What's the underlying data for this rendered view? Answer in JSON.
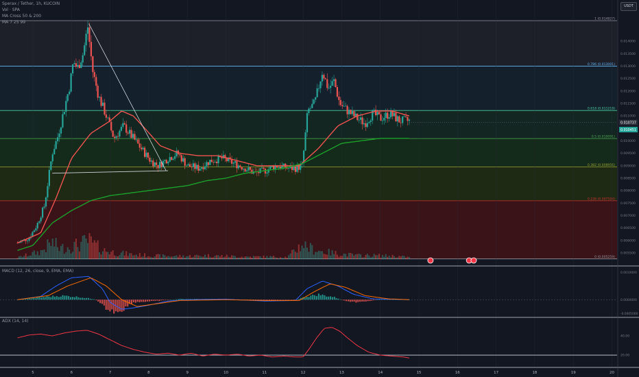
{
  "header": {
    "symbol_line": "Sperax / Tether, 1h, KUCOIN",
    "vol_line": "Vol · SPA",
    "ma1_line": "MA Cross 50 & 200",
    "ma2_line": "MA 7 25 99",
    "quote_badge": "USDT"
  },
  "colors": {
    "background": "#131722",
    "up": "#26a69a",
    "down": "#ef5350",
    "ma_fast": "#ef5350",
    "ma_slow": "#1ba12b",
    "macd": "#2962ff",
    "signal": "#ff6d00",
    "adx": "#f23645"
  },
  "chart_data": [
    {
      "type": "candlestick",
      "panel": "price",
      "title": "Sperax / Tether, 1h, KUCOIN",
      "x_ticks": [
        "5",
        "6",
        "7",
        "8",
        "9",
        "10",
        "11",
        "12",
        "13",
        "14",
        "15",
        "16",
        "17",
        "18",
        "19",
        "20"
      ],
      "y_ticks": [
        "0.014000",
        "0.013500",
        "0.013000",
        "0.012500",
        "0.012000",
        "0.011500",
        "0.011000",
        "0.010500",
        "0.010000",
        "0.009500",
        "0.009000",
        "0.008500",
        "0.008000",
        "0.007500",
        "0.007000",
        "0.006500",
        "0.006000",
        "0.005500"
      ],
      "ylim": [
        0.00525,
        0.01505
      ],
      "last_price_label": "0.010737",
      "prev_price_label": "0.010451",
      "fib_levels": [
        {
          "label": "1 (0.014827)",
          "value": 0.014827,
          "color": "#9598a1",
          "fill": "#1e2029"
        },
        {
          "label": "0.786 (0.013001)",
          "value": 0.013001,
          "color": "#64b5f6",
          "fill": "#14212d"
        },
        {
          "label": "0.618 (0.011218)",
          "value": 0.011218,
          "color": "#4dd0a0",
          "fill": "#132622"
        },
        {
          "label": "0.5 (0.010091)",
          "value": 0.010091,
          "color": "#4caf50",
          "fill": "#142a1a"
        },
        {
          "label": "0.382 (0.008956)",
          "value": 0.008956,
          "color": "#9fa835",
          "fill": "#1f2a15"
        },
        {
          "label": "0.236 (0.007594)",
          "value": 0.007594,
          "color": "#d32f2f",
          "fill": "#3a1318"
        },
        {
          "label": "0 (0.005259)",
          "value": 0.005259,
          "color": "#9598a1",
          "fill": "#3a1318"
        }
      ],
      "series": [
        {
          "name": "price",
          "keypoints": [
            [
              4.6,
              0.0059
            ],
            [
              4.9,
              0.0061
            ],
            [
              5.1,
              0.0066
            ],
            [
              5.3,
              0.0074
            ],
            [
              5.5,
              0.0095
            ],
            [
              5.65,
              0.0102
            ],
            [
              5.8,
              0.0112
            ],
            [
              5.95,
              0.0122
            ],
            [
              6.05,
              0.0132
            ],
            [
              6.15,
              0.0129
            ],
            [
              6.3,
              0.0135
            ],
            [
              6.42,
              0.0146
            ],
            [
              6.55,
              0.0128
            ],
            [
              6.7,
              0.0118
            ],
            [
              6.9,
              0.011
            ],
            [
              7.1,
              0.0101
            ],
            [
              7.35,
              0.0106
            ],
            [
              7.55,
              0.0102
            ],
            [
              7.8,
              0.0097
            ],
            [
              8.05,
              0.0092
            ],
            [
              8.25,
              0.009
            ],
            [
              8.5,
              0.0093
            ],
            [
              8.75,
              0.0095
            ],
            [
              9.0,
              0.009
            ],
            [
              9.3,
              0.0089
            ],
            [
              9.6,
              0.0092
            ],
            [
              9.9,
              0.0093
            ],
            [
              10.2,
              0.0091
            ],
            [
              10.5,
              0.0089
            ],
            [
              10.75,
              0.0087
            ],
            [
              11.0,
              0.0088
            ],
            [
              11.3,
              0.009
            ],
            [
              11.6,
              0.0089
            ],
            [
              11.8,
              0.0089
            ],
            [
              11.98,
              0.009
            ],
            [
              12.12,
              0.0112
            ],
            [
              12.3,
              0.0115
            ],
            [
              12.5,
              0.0128
            ],
            [
              12.65,
              0.0121
            ],
            [
              12.8,
              0.0124
            ],
            [
              12.95,
              0.0115
            ],
            [
              13.15,
              0.0112
            ],
            [
              13.4,
              0.0109
            ],
            [
              13.6,
              0.0107
            ],
            [
              13.8,
              0.0111
            ],
            [
              14.0,
              0.0109
            ],
            [
              14.25,
              0.0111
            ],
            [
              14.5,
              0.0108
            ],
            [
              14.75,
              0.0108
            ]
          ]
        },
        {
          "name": "MA fast",
          "keypoints": [
            [
              4.6,
              0.0059
            ],
            [
              5.2,
              0.0063
            ],
            [
              5.6,
              0.0077
            ],
            [
              6.0,
              0.0093
            ],
            [
              6.5,
              0.0103
            ],
            [
              7.0,
              0.0108
            ],
            [
              7.3,
              0.0112
            ],
            [
              7.6,
              0.011
            ],
            [
              7.9,
              0.0105
            ],
            [
              8.3,
              0.0098
            ],
            [
              8.8,
              0.0095
            ],
            [
              9.3,
              0.0094
            ],
            [
              9.8,
              0.0094
            ],
            [
              10.3,
              0.0092
            ],
            [
              10.8,
              0.009
            ],
            [
              11.3,
              0.009
            ],
            [
              11.9,
              0.009
            ],
            [
              12.4,
              0.0097
            ],
            [
              12.9,
              0.0106
            ],
            [
              13.4,
              0.011
            ],
            [
              13.9,
              0.0112
            ],
            [
              14.3,
              0.0112
            ],
            [
              14.75,
              0.011
            ]
          ]
        },
        {
          "name": "MA slow",
          "keypoints": [
            [
              4.6,
              0.0056
            ],
            [
              5.0,
              0.0058
            ],
            [
              5.5,
              0.0067
            ],
            [
              6.0,
              0.0072
            ],
            [
              6.5,
              0.0076
            ],
            [
              7.0,
              0.0078
            ],
            [
              7.5,
              0.0079
            ],
            [
              8.0,
              0.008
            ],
            [
              8.5,
              0.0081
            ],
            [
              9.0,
              0.0082
            ],
            [
              9.5,
              0.0084
            ],
            [
              10.0,
              0.0085
            ],
            [
              10.5,
              0.0087
            ],
            [
              11.0,
              0.0088
            ],
            [
              11.5,
              0.0089
            ],
            [
              12.0,
              0.0091
            ],
            [
              12.5,
              0.0095
            ],
            [
              13.0,
              0.0099
            ],
            [
              13.5,
              0.01
            ],
            [
              14.0,
              0.0101
            ],
            [
              14.5,
              0.0101
            ],
            [
              14.75,
              0.0101
            ]
          ]
        }
      ],
      "trend_lines": [
        {
          "from": [
            6.45,
            0.0147
          ],
          "to": [
            8.45,
            0.0088
          ]
        },
        {
          "from": [
            5.5,
            0.0087
          ],
          "to": [
            8.5,
            0.0088
          ]
        }
      ]
    },
    {
      "type": "bar",
      "panel": "volume",
      "title": "Vol · SPA",
      "note": "relative volume 0-1",
      "keypoints": [
        [
          4.6,
          0.05
        ],
        [
          5.2,
          0.25
        ],
        [
          5.5,
          0.55
        ],
        [
          5.7,
          0.35
        ],
        [
          6.1,
          0.45
        ],
        [
          6.45,
          0.6
        ],
        [
          6.8,
          0.3
        ],
        [
          7.2,
          0.2
        ],
        [
          7.6,
          0.15
        ],
        [
          8.0,
          0.12
        ],
        [
          8.5,
          0.1
        ],
        [
          9.0,
          0.1
        ],
        [
          9.5,
          0.12
        ],
        [
          10.0,
          0.1
        ],
        [
          10.5,
          0.08
        ],
        [
          11.0,
          0.08
        ],
        [
          11.6,
          0.07
        ],
        [
          11.98,
          0.5
        ],
        [
          12.2,
          0.35
        ],
        [
          12.5,
          0.25
        ],
        [
          12.9,
          0.18
        ],
        [
          13.4,
          0.12
        ],
        [
          13.9,
          0.12
        ],
        [
          14.4,
          0.1
        ],
        [
          14.75,
          0.06
        ]
      ]
    },
    {
      "type": "line",
      "panel": "macd",
      "title": "MACD (12, 26, close, 9, EMA, EMA)",
      "y_ticks": [
        "0.0010000",
        "0.0000000",
        "-0.0005000"
      ],
      "ylim": [
        -0.00062,
        0.00118
      ],
      "series": [
        {
          "name": "MACD",
          "keypoints": [
            [
              4.6,
              0.0
            ],
            [
              5.2,
              0.00012
            ],
            [
              5.6,
              0.0005
            ],
            [
              6.0,
              0.0008
            ],
            [
              6.45,
              0.00085
            ],
            [
              6.8,
              0.0004
            ],
            [
              7.0,
              -0.0001
            ],
            [
              7.3,
              -0.00035
            ],
            [
              7.6,
              -0.0003
            ],
            [
              8.0,
              -0.0002
            ],
            [
              8.5,
              -5e-05
            ],
            [
              9.0,
              0.0
            ],
            [
              10.0,
              2e-05
            ],
            [
              11.0,
              -5e-05
            ],
            [
              11.8,
              -3e-05
            ],
            [
              12.1,
              0.0004
            ],
            [
              12.5,
              0.00068
            ],
            [
              12.9,
              0.0005
            ],
            [
              13.3,
              0.0002
            ],
            [
              13.8,
              3e-05
            ],
            [
              14.75,
              0.0
            ]
          ]
        },
        {
          "name": "Signal",
          "keypoints": [
            [
              4.6,
              0.0
            ],
            [
              5.4,
              0.00015
            ],
            [
              5.9,
              0.0005
            ],
            [
              6.5,
              0.0008
            ],
            [
              6.9,
              0.0005
            ],
            [
              7.3,
              0.0
            ],
            [
              7.7,
              -0.00025
            ],
            [
              8.2,
              -0.00015
            ],
            [
              8.8,
              -3e-05
            ],
            [
              10.0,
              0.0
            ],
            [
              11.0,
              -3e-05
            ],
            [
              11.9,
              -3e-05
            ],
            [
              12.3,
              0.0003
            ],
            [
              12.7,
              0.00058
            ],
            [
              13.1,
              0.00045
            ],
            [
              13.6,
              0.00015
            ],
            [
              14.2,
              3e-05
            ],
            [
              14.75,
              0.0
            ]
          ]
        },
        {
          "name": "Histogram",
          "keypoints": [
            [
              4.6,
              0.0
            ],
            [
              5.4,
              0.00012
            ],
            [
              5.8,
              0.00015
            ],
            [
              6.2,
              0.0001
            ],
            [
              6.6,
              2e-05
            ],
            [
              7.0,
              -0.00045
            ],
            [
              7.3,
              -0.0004
            ],
            [
              7.6,
              -0.0001
            ],
            [
              8.2,
              -5e-05
            ],
            [
              8.8,
              3e-05
            ],
            [
              10.0,
              2e-05
            ],
            [
              10.8,
              -3e-05
            ],
            [
              11.8,
              0.0
            ],
            [
              12.1,
              0.00012
            ],
            [
              12.4,
              0.0002
            ],
            [
              12.8,
              0.0001
            ],
            [
              13.2,
              -0.0001
            ],
            [
              13.6,
              -8e-05
            ],
            [
              14.0,
              2e-05
            ],
            [
              14.75,
              0.0
            ]
          ]
        }
      ]
    },
    {
      "type": "line",
      "panel": "adx",
      "title": "ADX (14, 14)",
      "y_ticks": [
        "40.00",
        "20.00"
      ],
      "ylim": [
        10,
        58
      ],
      "series": [
        {
          "name": "ADX",
          "keypoints": [
            [
              4.6,
              38
            ],
            [
              4.9,
              41
            ],
            [
              5.2,
              42
            ],
            [
              5.5,
              40
            ],
            [
              5.8,
              43
            ],
            [
              6.1,
              45
            ],
            [
              6.4,
              46
            ],
            [
              6.7,
              42
            ],
            [
              7.0,
              36
            ],
            [
              7.3,
              30
            ],
            [
              7.6,
              26
            ],
            [
              7.9,
              23
            ],
            [
              8.2,
              21
            ],
            [
              8.5,
              22
            ],
            [
              8.8,
              20
            ],
            [
              9.1,
              22
            ],
            [
              9.4,
              19
            ],
            [
              9.7,
              21
            ],
            [
              10.0,
              20
            ],
            [
              10.3,
              21
            ],
            [
              10.6,
              19
            ],
            [
              10.9,
              20
            ],
            [
              11.2,
              18
            ],
            [
              11.5,
              19
            ],
            [
              11.8,
              18
            ],
            [
              12.0,
              18
            ],
            [
              12.15,
              26
            ],
            [
              12.35,
              38
            ],
            [
              12.55,
              48
            ],
            [
              12.75,
              49
            ],
            [
              12.95,
              45
            ],
            [
              13.15,
              38
            ],
            [
              13.4,
              30
            ],
            [
              13.7,
              23
            ],
            [
              14.0,
              20
            ],
            [
              14.3,
              19
            ],
            [
              14.6,
              18
            ],
            [
              14.75,
              17
            ]
          ]
        }
      ]
    }
  ]
}
